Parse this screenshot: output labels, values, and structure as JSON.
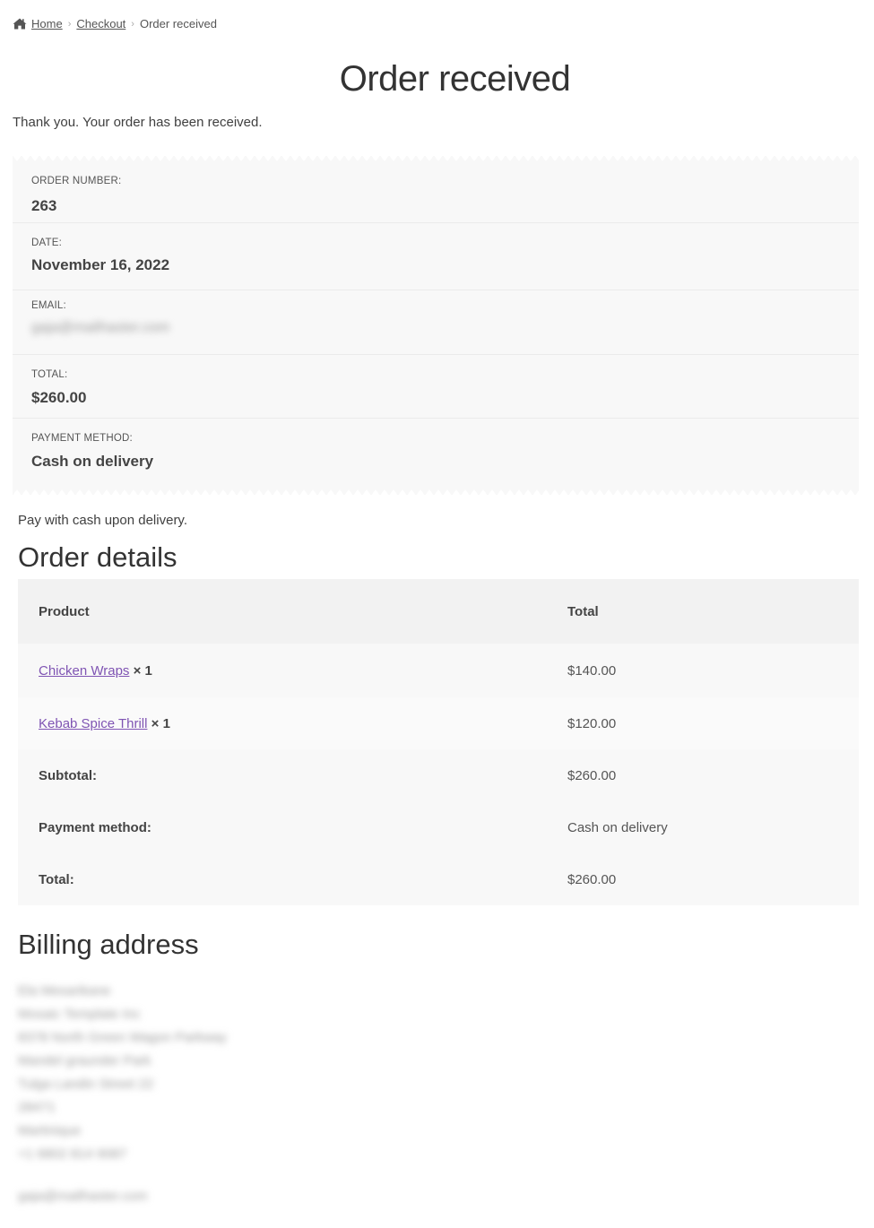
{
  "breadcrumb": {
    "home": "Home",
    "checkout": "Checkout",
    "current": "Order received"
  },
  "page_title": "Order received",
  "thank_you": "Thank you. Your order has been received.",
  "overview": {
    "order_number_label": "ORDER NUMBER:",
    "order_number": "263",
    "date_label": "DATE:",
    "date": "November 16, 2022",
    "email_label": "EMAIL:",
    "email": "gaja@mailhaster.com",
    "total_label": "TOTAL:",
    "total": "$260.00",
    "payment_label": "PAYMENT METHOD:",
    "payment": "Cash on delivery"
  },
  "payment_note": "Pay with cash upon delivery.",
  "order_details": {
    "title": "Order details",
    "header_product": "Product",
    "header_total": "Total",
    "items": [
      {
        "name": "Chicken Wraps",
        "qty": "× 1",
        "total": "$140.00"
      },
      {
        "name": "Kebab Spice Thrill",
        "qty": "× 1",
        "total": "$120.00"
      }
    ],
    "subtotal_label": "Subtotal:",
    "subtotal": "$260.00",
    "payment_label": "Payment method:",
    "payment": "Cash on delivery",
    "total_label": "Total:",
    "total": "$260.00"
  },
  "billing": {
    "title": "Billing address",
    "lines": [
      "Ela Mesarikane",
      "Mosaic Template Inc",
      "8378 North Green Wagon Parkway",
      "Mandel graunder Park",
      "Tulga Landin Street 22",
      "28471",
      "Martinique",
      "+1 6802 814 9087"
    ],
    "email": "gaja@mailhaster.com"
  },
  "colors": {
    "link": "#7f54b3",
    "panel_bg": "#f8f8f8"
  }
}
